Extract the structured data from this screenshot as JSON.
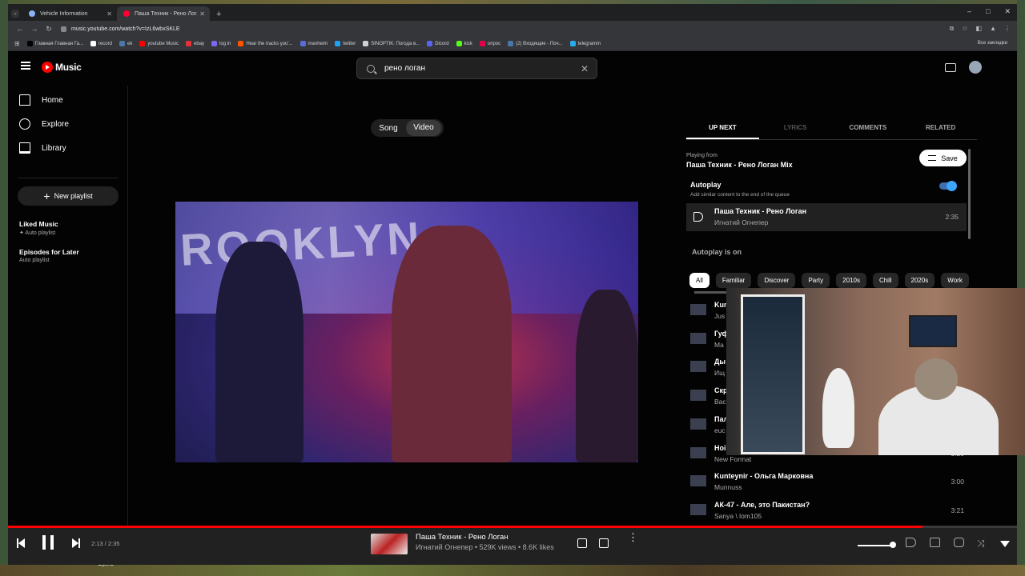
{
  "browser": {
    "tabs": [
      {
        "title": "Vehicle Information",
        "favicon_color": "#8ab4f8"
      },
      {
        "title": "Паша Техник - Рено Логан",
        "favicon_color": "#ff0033"
      }
    ],
    "url": "music.youtube.com/watch?v=IzL6wbxSKLE",
    "bookmarks": [
      {
        "label": "Главная Главная Га...",
        "color": "#000000"
      },
      {
        "label": "record",
        "color": "#ffffff"
      },
      {
        "label": "ek",
        "color": "#4a76a8"
      },
      {
        "label": "youtube Music",
        "color": "#ff0000"
      },
      {
        "label": "ebay",
        "color": "#e53238"
      },
      {
        "label": "log in",
        "color": "#7b68ee"
      },
      {
        "label": "Hear the tracks you'...",
        "color": "#ff5500"
      },
      {
        "label": "manheim",
        "color": "#5b6bd8"
      },
      {
        "label": "twitter",
        "color": "#1da1f2"
      },
      {
        "label": "SINOPTIK: Погода в...",
        "color": "#cfd2d6"
      },
      {
        "label": "Dicord",
        "color": "#5865f2"
      },
      {
        "label": "kick",
        "color": "#53fc18"
      },
      {
        "label": "опрос",
        "color": "#e6004c"
      },
      {
        "label": "(2) Входящие - Поч...",
        "color": "#4a76a8"
      },
      {
        "label": "telegramm",
        "color": "#2aabee"
      }
    ],
    "all_bookmarks": "Все закладки"
  },
  "header": {
    "logo_text": "Music",
    "search_value": "рено логан"
  },
  "sidebar": {
    "items": [
      {
        "label": "Home",
        "icon": "home-icon"
      },
      {
        "label": "Explore",
        "icon": "explore-icon"
      },
      {
        "label": "Library",
        "icon": "library-icon"
      }
    ],
    "new_playlist": "New playlist",
    "playlists": [
      {
        "title": "Liked Music",
        "sub": "✦ Auto playlist"
      },
      {
        "title": "Episodes for Later",
        "sub": "Auto playlist"
      }
    ]
  },
  "player_toggle": {
    "song": "Song",
    "video": "Video"
  },
  "video": {
    "overlay_text": "ROOKLYN"
  },
  "right_panel": {
    "tabs": [
      "UP NEXT",
      "LYRICS",
      "COMMENTS",
      "RELATED"
    ],
    "playing_from_label": "Playing from",
    "mix_title": "Паша Техник - Рено Логан Mix",
    "save_label": "Save",
    "autoplay_title": "Autoplay",
    "autoplay_sub": "Add similar content to the end of the queue",
    "autoplay_enabled": true,
    "current": {
      "title": "Паша Техник - Рено Логан",
      "artist": "Игнатий Огнепер",
      "duration": "2:35"
    },
    "autoplay_on": "Autoplay is on",
    "chips": [
      "All",
      "Familiar",
      "Discover",
      "Party",
      "2010s",
      "Chill",
      "2020s",
      "Work"
    ],
    "queue": [
      {
        "title": "Kun",
        "artist": "Jus",
        "duration": ""
      },
      {
        "title": "Гуф",
        "artist": "Ма",
        "duration": ""
      },
      {
        "title": "Ды",
        "artist": "Ищ",
        "duration": ""
      },
      {
        "title": "Скр",
        "artist": "Вас",
        "duration": ""
      },
      {
        "title": "Пал",
        "artist": "euc",
        "duration": ""
      },
      {
        "title": "Ноі",
        "artist": "New Format",
        "duration": "3:20"
      },
      {
        "title": "Kunteynir - Ольга Марковна",
        "artist": "Munnuss",
        "duration": "3:00"
      },
      {
        "title": "АК-47 - Але, это Пакистан?",
        "artist": "Sanya \\ lom105",
        "duration": "3:21"
      }
    ]
  },
  "player_bar": {
    "time": "2:13 / 2:35",
    "progress_fraction": 0.906,
    "title": "Паша Техник - Рено Логан",
    "meta": "Игнатий Огнепер • 529K views • 8.6K likes",
    "volume_fraction": 0.95
  },
  "taskbar": {
    "opera_label": "Opera"
  }
}
